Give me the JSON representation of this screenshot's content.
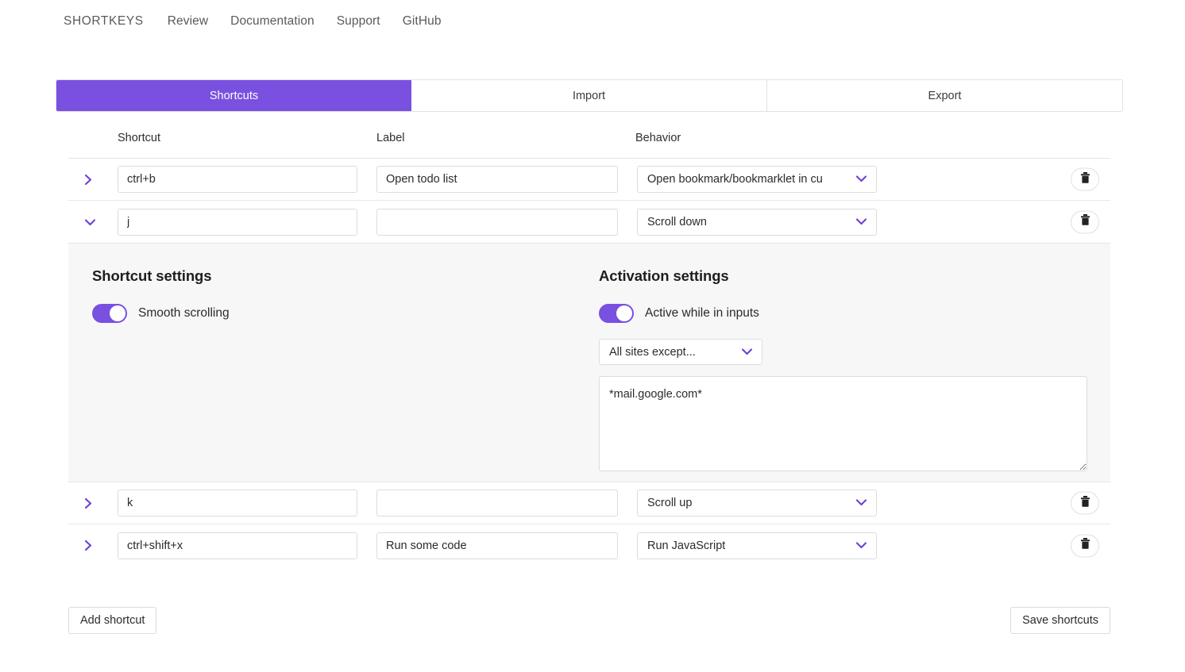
{
  "nav": {
    "items": [
      {
        "label": "SHORTKEYS",
        "name": "nav-link-shortkeys"
      },
      {
        "label": "Review",
        "name": "nav-link-review"
      },
      {
        "label": "Documentation",
        "name": "nav-link-documentation"
      },
      {
        "label": "Support",
        "name": "nav-link-support"
      },
      {
        "label": "GitHub",
        "name": "nav-link-github"
      }
    ]
  },
  "tabs": [
    {
      "label": "Shortcuts",
      "active": true
    },
    {
      "label": "Import",
      "active": false
    },
    {
      "label": "Export",
      "active": false
    }
  ],
  "table": {
    "headers": {
      "shortcut": "Shortcut",
      "label": "Label",
      "behavior": "Behavior"
    },
    "rows": [
      {
        "expanded": false,
        "shortcut": "ctrl+b",
        "label": "Open todo list",
        "label_placeholder": "",
        "behavior": "Open bookmark/bookmarklet in cu"
      },
      {
        "expanded": true,
        "shortcut": "j",
        "label": "",
        "label_placeholder": "",
        "behavior": "Scroll down"
      },
      {
        "expanded": false,
        "shortcut": "k",
        "label": "",
        "label_placeholder": "",
        "behavior": "Scroll up"
      },
      {
        "expanded": false,
        "shortcut": "ctrl+shift+x",
        "label": "Run some code",
        "label_placeholder": "",
        "behavior": "Run JavaScript"
      }
    ]
  },
  "settings": {
    "shortcut_settings_title": "Shortcut settings",
    "smooth_scrolling_label": "Smooth scrolling",
    "smooth_scrolling_on": true,
    "activation_settings_title": "Activation settings",
    "active_in_inputs_label": "Active while in inputs",
    "active_in_inputs_on": true,
    "site_scope": "All sites except...",
    "sites_value": "*mail.google.com*",
    "sites_placeholder": ""
  },
  "footer": {
    "add_label": "Add shortcut",
    "save_label": "Save shortcuts"
  },
  "icons": {
    "chevron_right": "chevron-right-icon",
    "chevron_down": "chevron-down-icon",
    "caret": "chevron-down-icon",
    "trash": "trash-icon"
  },
  "colors": {
    "accent": "#7a50e0",
    "panel_bg": "#f7f7f8",
    "border": "#dcdce0",
    "text": "#2b2b2b"
  }
}
